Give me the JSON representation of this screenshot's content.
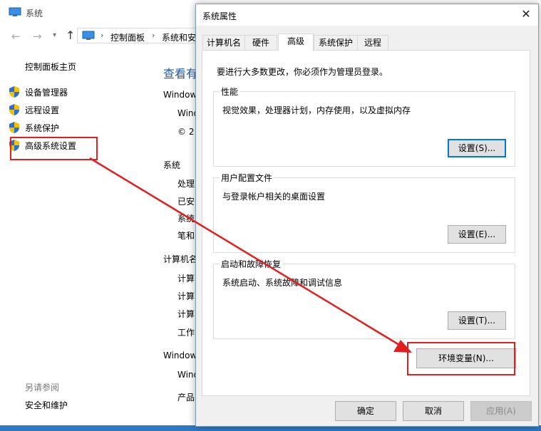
{
  "system_window": {
    "title": "系统",
    "breadcrumb": [
      "控制面板",
      "系统和安"
    ],
    "sidebar": {
      "home": "控制面板主页",
      "items": [
        {
          "label": "设备管理器",
          "icon": "shield-icon"
        },
        {
          "label": "远程设置",
          "icon": "shield-icon"
        },
        {
          "label": "系统保护",
          "icon": "shield-icon"
        },
        {
          "label": "高级系统设置",
          "icon": "shield-icon"
        }
      ],
      "see_also": "另请参阅",
      "security_link": "安全和维护"
    },
    "main": {
      "heading": "查看有",
      "lines": [
        "Window",
        "Wind",
        "© 2",
        "系统",
        "处理",
        "已安",
        "系统",
        "笔和",
        "计算机名",
        "计算",
        "计算",
        "计算",
        "工作",
        "Window",
        "Wind",
        "产品"
      ]
    }
  },
  "dialog": {
    "title": "系统属性",
    "close_glyph": "✕",
    "tabs": [
      {
        "label": "计算机名",
        "active": false
      },
      {
        "label": "硬件",
        "active": false
      },
      {
        "label": "高级",
        "active": true
      },
      {
        "label": "系统保护",
        "active": false
      },
      {
        "label": "远程",
        "active": false
      }
    ],
    "admin_note": "要进行大多数更改，你必须作为管理员登录。",
    "groups": [
      {
        "title": "性能",
        "desc": "视觉效果，处理器计划，内存使用，以及虚拟内存",
        "button": "设置(S)..."
      },
      {
        "title": "用户配置文件",
        "desc": "与登录帐户相关的桌面设置",
        "button": "设置(E)..."
      },
      {
        "title": "启动和故障恢复",
        "desc": "系统启动、系统故障和调试信息",
        "button": "设置(T)..."
      }
    ],
    "env_button": "环境变量(N)...",
    "footer": {
      "ok": "确定",
      "cancel": "取消",
      "apply": "应用(A)"
    }
  },
  "colors": {
    "annotation": "#e02020",
    "link_heading": "#1e5aa8",
    "focus": "#0078d7"
  }
}
